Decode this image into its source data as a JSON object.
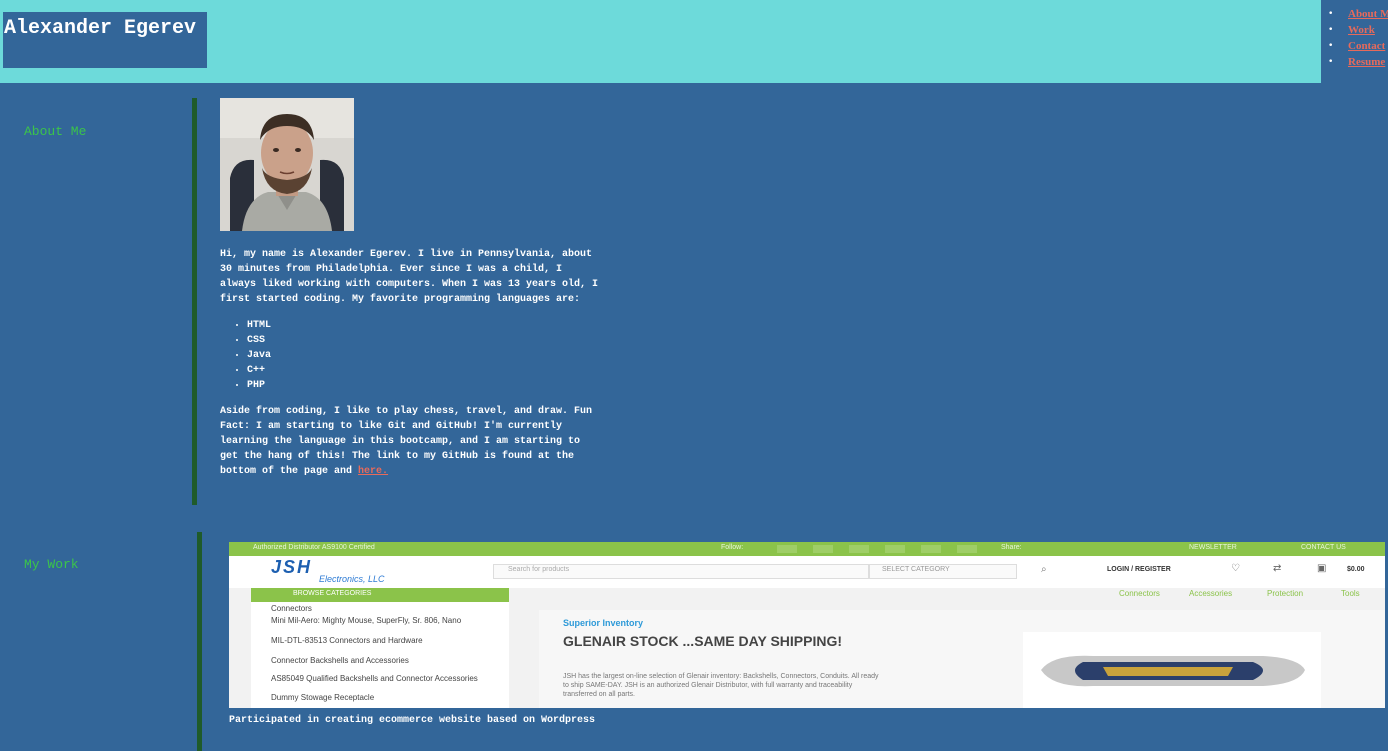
{
  "header": {
    "name": "Alexander Egerev",
    "nav": [
      "About Me",
      "Work",
      "Contact",
      "Resume"
    ]
  },
  "about": {
    "heading": "About Me",
    "intro": "Hi, my name is Alexander Egerev. I live in Pennsylvania, about 30 minutes from Philadelphia. Ever since I was a child, I always liked working with computers. When I was 13 years old, I first started coding. My favorite programming languages are:",
    "languages": [
      "HTML",
      "CSS",
      "Java",
      "C++",
      "PHP"
    ],
    "outro": "Aside from coding, I like to play chess, travel, and draw. Fun Fact: I am starting to like Git and GitHub! I'm currently learning the language in this bootcamp, and I am starting to get the hang of this! The link to my GitHub is found at the bottom of the page and ",
    "link_text": "here."
  },
  "work": {
    "heading": "My Work",
    "caption": "Participated in creating ecommerce website based on Wordpress",
    "preview": {
      "topbar_text": "Authorized Distributor AS9100 Certified",
      "follow": "Follow:",
      "share": "Share:",
      "newsletter": "NEWSLETTER",
      "contact": "CONTACT US",
      "logo": "JSH",
      "logo_sub": "Electronics, LLC",
      "search_placeholder": "Search for products",
      "category": "SELECT CATEGORY",
      "login": "LOGIN / REGISTER",
      "cart": "$0.00",
      "browse": "BROWSE CATEGORIES",
      "menu": [
        "Connectors",
        "Accessories",
        "Protection",
        "Tools"
      ],
      "categories": [
        "Connectors",
        "Mini Mil-Aero: Mighty Mouse, SuperFly, Sr. 806, Nano",
        "MIL-DTL-83513 Connectors and Hardware",
        "Connector Backshells and Accessories",
        "AS85049 Qualified Backshells and Connector Accessories",
        "Dummy Stowage Receptacle"
      ],
      "kicker": "Superior Inventory",
      "headline": "GLENAIR STOCK ...SAME DAY SHIPPING!",
      "blurb": "JSH has the largest on-line selection of Glenair inventory: Backshells, Connectors, Conduits. All ready to ship SAME-DAY. JSH is an authorized Glenair Distributor, with full warranty and traceability transferred on all parts."
    }
  },
  "colors": {
    "page_bg": "#336699",
    "header_bg": "#6ddada",
    "heading": "#3bc44b",
    "link": "#e76a5b",
    "divider": "#1f5b2a",
    "preview_green": "#8bc34a"
  }
}
